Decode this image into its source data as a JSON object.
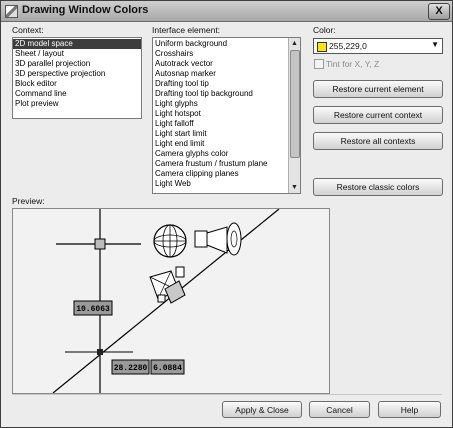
{
  "window": {
    "title": "Drawing Window Colors",
    "close_label": "X"
  },
  "context": {
    "label": "Context:",
    "items": [
      "2D model space",
      "Sheet / layout",
      "3D parallel projection",
      "3D perspective projection",
      "Block editor",
      "Command line",
      "Plot preview"
    ],
    "selected_index": 0
  },
  "interface": {
    "label": "Interface element:",
    "items": [
      "Uniform background",
      "Crosshairs",
      "Autotrack vector",
      "Autosnap marker",
      "Drafting tool tip",
      "Drafting tool tip background",
      "Light glyphs",
      "Light hotspot",
      "Light falloff",
      "Light start limit",
      "Light end limit",
      "Camera glyphs color",
      "Camera frustum / frustum plane",
      "Camera clipping planes",
      "Light Web"
    ]
  },
  "color": {
    "label": "Color:",
    "value": "255,229,0",
    "swatch": "#ffe500",
    "tint_label": "Tint for X, Y, Z",
    "tint_checked": false
  },
  "buttons": {
    "restore_element": "Restore current element",
    "restore_context": "Restore current context",
    "restore_all": "Restore all contexts",
    "restore_classic": "Restore classic colors",
    "apply_close": "Apply & Close",
    "cancel": "Cancel",
    "help": "Help"
  },
  "preview": {
    "label": "Preview:",
    "tooltip_1": "10.6063",
    "tooltip_2": "28.2280",
    "tooltip_3": "6.0884"
  }
}
